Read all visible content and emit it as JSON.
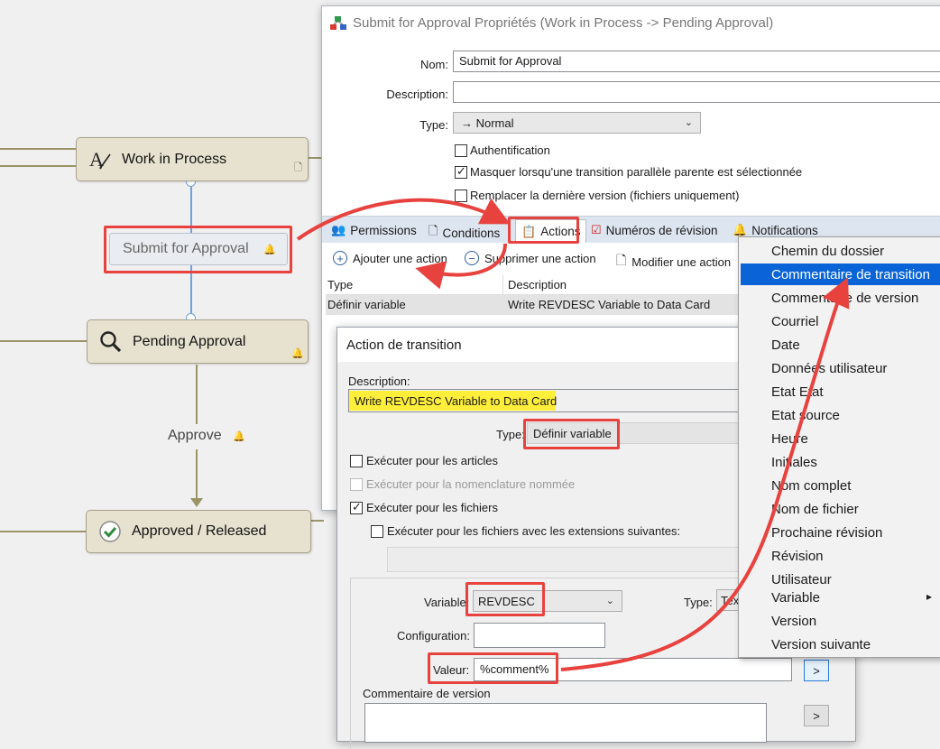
{
  "workflow": {
    "states": {
      "work_in_process": "Work in Process",
      "pending_approval": "Pending Approval",
      "approved_released": "Approved / Released"
    },
    "transition_submit": "Submit for Approval",
    "transition_approve": "Approve"
  },
  "properties_dialog": {
    "title": "Submit for Approval Propriétés (Work in Process -> Pending Approval)",
    "name_label": "Nom:",
    "name_value": "Submit for Approval",
    "description_label": "Description:",
    "description_value": "",
    "type_label": "Type:",
    "type_value": "→ Normal",
    "checkboxes": [
      {
        "label": "Authentification",
        "checked": false
      },
      {
        "label": "Masquer lorsqu'une transition parallèle parente est sélectionnée",
        "checked": true
      },
      {
        "label": "Remplacer la dernière version (fichiers uniquement)",
        "checked": false
      }
    ],
    "tabs": [
      "Permissions",
      "Conditions",
      "Actions",
      "Numéros de révision",
      "Notifications"
    ],
    "toolbar": {
      "add": "Ajouter une action",
      "delete": "Supprimer une action",
      "edit": "Modifier une action"
    },
    "grid": {
      "columns": [
        "Type",
        "Description"
      ],
      "rows": [
        [
          "Définir variable",
          "Write REVDESC Variable to Data Card"
        ]
      ]
    }
  },
  "action_dialog": {
    "title": "Action de transition",
    "description_label": "Description:",
    "description_value": "Write REVDESC Variable to Data Card",
    "type_label": "Type:",
    "type_value": "Définir variable",
    "options": [
      {
        "label": "Exécuter pour les articles",
        "checked": false,
        "enabled": true
      },
      {
        "label": "Exécuter pour la nomenclature nommée",
        "checked": false,
        "enabled": false
      },
      {
        "label": "Exécuter pour les fichiers",
        "checked": true,
        "enabled": true
      },
      {
        "label": "Exécuter pour les fichiers avec les extensions suivantes:",
        "checked": false,
        "enabled": true
      }
    ],
    "variable_label": "Variable:",
    "variable_value": "REVDESC",
    "type2_label": "Type:",
    "type2_value": "Tex",
    "configuration_label": "Configuration:",
    "configuration_value": "",
    "value_label": "Valeur:",
    "value_value": "%comment%",
    "version_comment_label": "Commentaire de version",
    "browse_button": ">"
  },
  "context_menu": {
    "items": [
      "Chemin du dossier",
      "Commentaire de transition",
      "Commentaire de version",
      "Courriel",
      "Date",
      "Données utilisateur",
      "Etat Etat",
      "Etat source",
      "Heure",
      "Initiales",
      "Nom complet",
      "Nom de fichier",
      "Prochaine révision",
      "Révision",
      "Utilisateur",
      "Variable",
      "Version",
      "Version suivante"
    ],
    "highlighted_index": 1,
    "submenu_arrow": "▸"
  },
  "colors": {
    "annotation_red": "#e8423f",
    "highlight_yellow": "#ffef3a",
    "menu_selection": "#0a64d7",
    "state_fill": "#e7e2cf",
    "connector": "#9a9467"
  }
}
